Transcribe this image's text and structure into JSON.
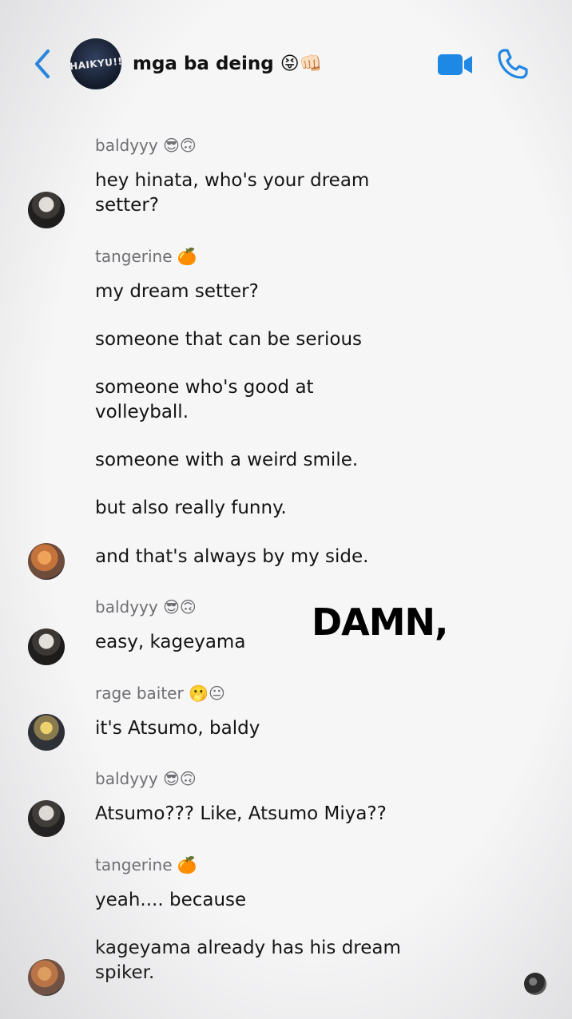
{
  "header": {
    "group_avatar_text": "HAIKYU!!",
    "title": "mga ba deing 😝👊🏻",
    "back_icon": "chevron-left-icon",
    "video_icon": "video-camera-icon",
    "call_icon": "phone-icon",
    "accent_color": "#1E88E5"
  },
  "messages": [
    {
      "sender": "baldyyy 😎🙃",
      "texts": [
        "hey hinata, who's your dream setter?"
      ]
    },
    {
      "sender": "tangerine 🍊",
      "texts": [
        "my dream setter?",
        "someone that can be serious",
        "someone who's good at volleyball.",
        "someone with a weird smile.",
        "but also really funny.",
        "and that's always by my side."
      ]
    },
    {
      "sender": "baldyyy 😎🙃",
      "texts": [
        "easy, kageyama"
      ]
    },
    {
      "sender": "rage baiter 🫢😐",
      "texts": [
        "it's Atsumo, baldy"
      ]
    },
    {
      "sender": "baldyyy 😎🙃",
      "texts": [
        "Atsumo??? Like, Atsumo Miya??"
      ]
    },
    {
      "sender": "tangerine 🍊",
      "texts": [
        "yeah.... because",
        "kageyama already has his dream spiker."
      ]
    }
  ],
  "overlay": {
    "caption": "DAMN,"
  }
}
